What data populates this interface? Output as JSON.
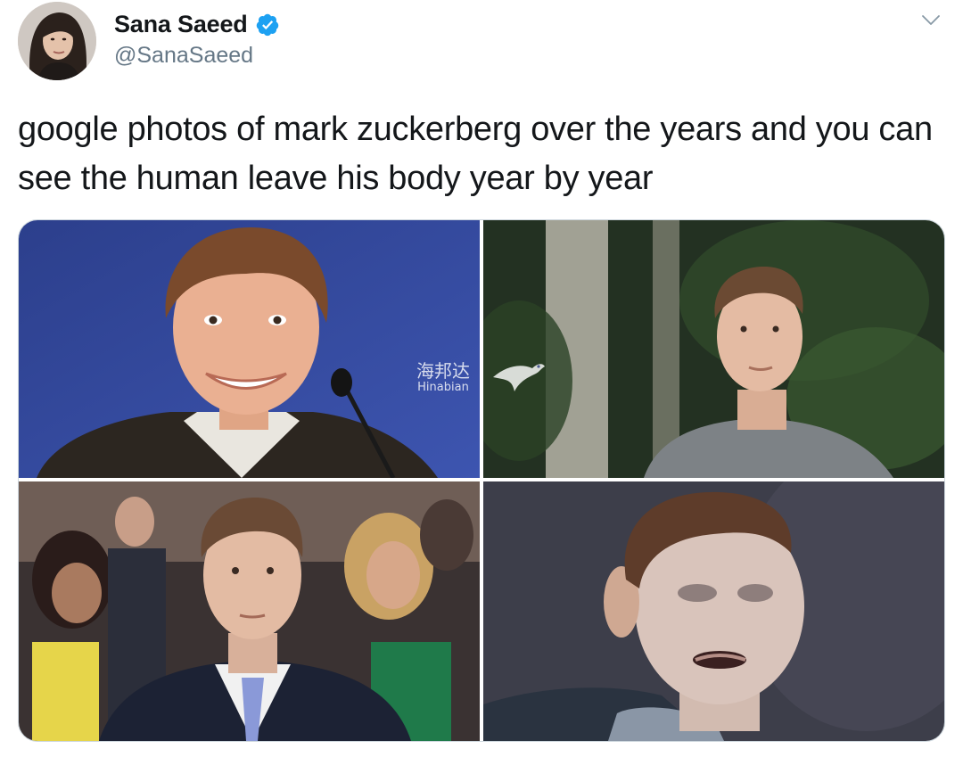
{
  "tweet": {
    "author": {
      "display_name": "Sana Saeed",
      "handle": "@SanaSaeed",
      "verified": true
    },
    "text": "google photos of mark zuckerberg over the years and you can see the human leave his body year by year",
    "menu_icon": "chevron-down-icon",
    "verified_icon": "verified-badge-icon",
    "accent_color": "#1da1f2"
  },
  "media": {
    "watermark": {
      "chinese": "海邦达",
      "latin": "Hinabian"
    }
  }
}
